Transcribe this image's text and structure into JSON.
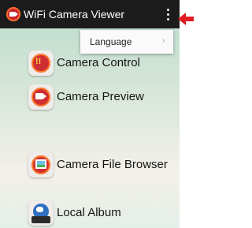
{
  "app_bar": {
    "title": "WiFi Camera Viewer",
    "app_icon": "camera-app-icon",
    "overflow_icon": "more-vert-icon"
  },
  "overflow_menu": {
    "items": [
      {
        "label": "Language",
        "icon": "chevron-right-icon",
        "chevron": "›"
      }
    ]
  },
  "main_menu": {
    "items": [
      {
        "label": "Camera Control",
        "icon": "camera-control-icon",
        "icon_text": "((!))"
      },
      {
        "label": "Camera Preview",
        "icon": "camera-preview-icon"
      },
      {
        "label": "Camera File Browser",
        "icon": "file-browser-icon"
      },
      {
        "label": "Local Album",
        "icon": "local-album-icon"
      }
    ]
  },
  "annotation": {
    "arrow_icon": "red-pointer-arrow-icon",
    "color": "#e21b23"
  },
  "colors": {
    "app_bar_bg": "#1c1c1c",
    "accent_red": "#cf2f32"
  }
}
